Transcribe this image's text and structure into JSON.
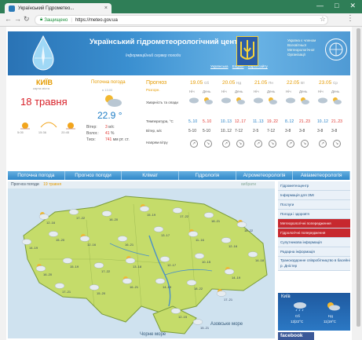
{
  "browser": {
    "tab_title": "Український Гідрометео...",
    "tab_close": "×",
    "win_controls": [
      "—",
      "□",
      "✕"
    ],
    "security": "Защищено",
    "url": "https://meteo.gov.ua",
    "icons": [
      "back-icon",
      "forward-icon",
      "reload-icon",
      "lock-icon",
      "star-icon",
      "menu-icon"
    ]
  },
  "banner": {
    "title": "Український гідрометеорологічний центр",
    "subtitle": "Інформаційний сервер погоди",
    "links": [
      "Українська",
      "English",
      "Карта сайту"
    ],
    "wmo_text": "Україна є членом Всесвітньої Метеорологічної Організації"
  },
  "city": {
    "name": "КИЇВ",
    "sub": "карта міста",
    "date": "18 травня",
    "sunrise": "5:05",
    "sunset": "20:45",
    "daylen": "15:36"
  },
  "current": {
    "title": "Поточна погода",
    "time": "в 13:00",
    "temp": "22.9 °",
    "rows": [
      {
        "label": "Вітер:",
        "value": "3",
        "unit": "м/с"
      },
      {
        "label": "Волог.:",
        "value": "41",
        "unit": "%"
      },
      {
        "label": "Тиск:",
        "value": "741",
        "unit": "мм рт. ст."
      }
    ]
  },
  "forecast": {
    "label": "Прогноз",
    "label_sub": "Розгорн.",
    "row_labels": [
      "Хмарність та опади",
      "Температура, °С",
      "Вітер, м/с",
      "Напрям вітру"
    ],
    "days": [
      {
        "date": "19.05",
        "dow": "Сб",
        "halves": [
          "Ніч",
          "День"
        ],
        "temps": [
          "5..10",
          "5..10"
        ],
        "wind": [
          "5-10",
          "5-10"
        ]
      },
      {
        "date": "20.05",
        "dow": "Нд",
        "halves": [
          "Ніч",
          "День"
        ],
        "temps": [
          "10..13",
          "12..17"
        ],
        "wind": [
          "10..12",
          "7-12"
        ]
      },
      {
        "date": "21.05",
        "dow": "Пн",
        "halves": [
          "Ніч",
          "День"
        ],
        "temps": [
          "11..13",
          "19..22"
        ],
        "wind": [
          "2-5",
          "7-12"
        ]
      },
      {
        "date": "22.05",
        "dow": "Вт",
        "halves": [
          "Ніч",
          "День"
        ],
        "temps": [
          "8..12",
          "21..23"
        ],
        "wind": [
          "3-8",
          "3-8"
        ]
      },
      {
        "date": "23.05",
        "dow": "Ср",
        "halves": [
          "Ніч",
          "День"
        ],
        "temps": [
          "10..12",
          "21..23"
        ],
        "wind": [
          "3-8",
          "3-8"
        ]
      }
    ]
  },
  "menu": [
    "Поточна погода",
    "Прогноз погоди",
    "Клімат",
    "Гідрологія",
    "Агрометеорологія",
    "Авіаметеорологія"
  ],
  "map": {
    "head": "Прогноз погоди",
    "head_date": "19 травня",
    "head_all": "вибрати",
    "seas": [
      "Азовське море",
      "Чорне море"
    ],
    "cities": [
      "12..16",
      "17..22",
      "16..20",
      "15..19",
      "17..22",
      "18..21",
      "18..22",
      "14..19",
      "15..20",
      "12..16",
      "16..21",
      "13..17",
      "11..16",
      "12..16",
      "14..18",
      "16..20",
      "15..19",
      "17..22",
      "13..18",
      "12..17",
      "10..15",
      "14..19",
      "17..21",
      "15..20",
      "16..21",
      "14..19",
      "18..22",
      "17..21",
      "12..15",
      "15..21"
    ]
  },
  "sidebar": {
    "items": [
      "Гідрометеоцентр",
      "Інформація для ЗМІ",
      "Послуги",
      "Погода і здоров'я",
      "Метеорологічні попередження",
      "Гідрологічні попередження",
      "Супутникова інформація",
      "Радарна інформація",
      "Транскордонне співробітництво в басейні р. Дністер"
    ],
    "kyiv": {
      "name": "Київ",
      "days": [
        {
          "label": "Сб",
          "temp": "12|22°С"
        },
        {
          "label": "Нд",
          "temp": "11|19°С"
        }
      ]
    },
    "facebook": "facebook"
  },
  "colors": {
    "chrome": "#2f7e57",
    "banner": "#2a73b5",
    "accent_orange": "#e59b00",
    "date_red": "#d81f27",
    "temp_blue": "#1e7dc5",
    "map_land": "#c5dc6a",
    "sea": "#a9cfe6"
  }
}
